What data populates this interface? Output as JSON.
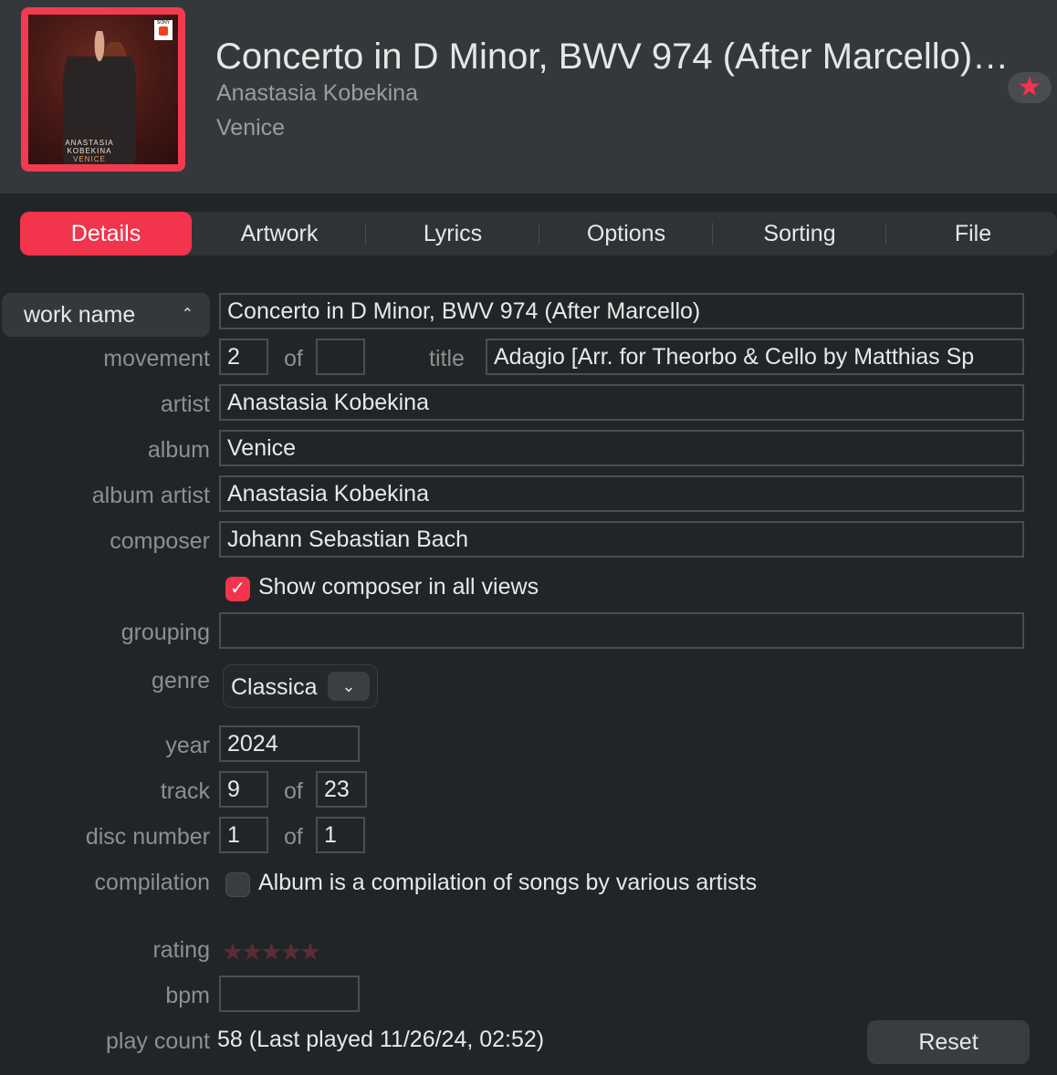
{
  "header": {
    "title": "Concerto in D Minor, BWV 974 (After Marcello)…",
    "artist": "Anastasia Kobekina",
    "album": "Venice",
    "artwork": {
      "line1": "ANASTASIA",
      "line2": "KOBEKINA",
      "line3": "VENICE",
      "label": "SONY"
    },
    "love_icon": "star-icon",
    "love_color": "#f2344c"
  },
  "tabs": [
    {
      "label": "Details",
      "active": true
    },
    {
      "label": "Artwork"
    },
    {
      "label": "Lyrics"
    },
    {
      "label": "Options"
    },
    {
      "label": "Sorting"
    },
    {
      "label": "File"
    }
  ],
  "form": {
    "work_name_select": "work name",
    "work_name_value": "Concerto in D Minor, BWV 974 (After Marcello)",
    "movement_label": "movement",
    "movement_value": "2",
    "of_label": "of",
    "movement_of_value": "",
    "title_label": "title",
    "title_value": "Adagio [Arr. for Theorbo & Cello by Matthias Sp",
    "artist_label": "artist",
    "artist_value": "Anastasia Kobekina",
    "album_label": "album",
    "album_value": "Venice",
    "album_artist_label": "album artist",
    "album_artist_value": "Anastasia Kobekina",
    "composer_label": "composer",
    "composer_value": "Johann Sebastian Bach",
    "show_composer_text": "Show composer in all views",
    "show_composer_checked": true,
    "grouping_label": "grouping",
    "grouping_value": "",
    "genre_label": "genre",
    "genre_value": "Classical",
    "year_label": "year",
    "year_value": "2024",
    "track_label": "track",
    "track_value": "9",
    "track_of_value": "23",
    "disc_label": "disc number",
    "disc_value": "1",
    "disc_of_value": "1",
    "compilation_label": "compilation",
    "compilation_text": "Album is a compilation of songs by various artists",
    "compilation_checked": false,
    "rating_label": "rating",
    "rating_value": 0,
    "rating_stars": "★★★★★",
    "bpm_label": "bpm",
    "bpm_value": "",
    "playcount_label": "play count",
    "playcount_value": "58 (Last played 11/26/24, 02:52)",
    "reset_label": "Reset"
  },
  "colors": {
    "accent": "#f2344c",
    "background": "#222527",
    "header_bg": "#35383b"
  }
}
